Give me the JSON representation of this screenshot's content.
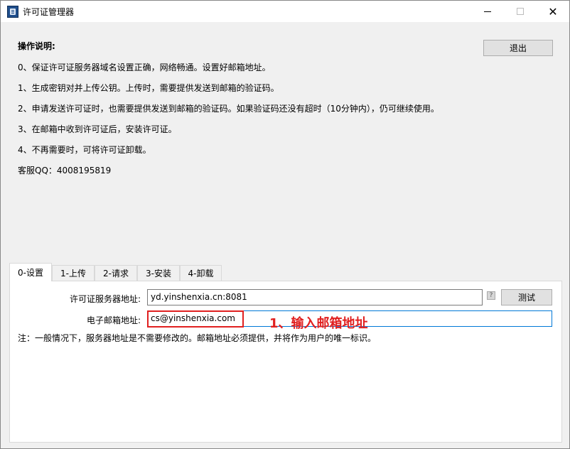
{
  "window": {
    "title": "许可证管理器",
    "close_glyph": "✕"
  },
  "instructions": {
    "heading": "操作说明:",
    "lines": [
      "0、保证许可证服务器域名设置正确，网络畅通。设置好邮箱地址。",
      "1、生成密钥对并上传公钥。上传时，需要提供发送到邮箱的验证码。",
      "2、申请发送许可证时，也需要提供发送到邮箱的验证码。如果验证码还没有超时（10分钟内），仍可继续使用。",
      "3、在邮箱中收到许可证后，安装许可证。",
      "4、不再需要时，可将许可证卸载。",
      "客服QQ：4008195819"
    ]
  },
  "exit_label": "退出",
  "tabs": [
    {
      "label": "0-设置",
      "active": true
    },
    {
      "label": "1-上传",
      "active": false
    },
    {
      "label": "2-请求",
      "active": false
    },
    {
      "label": "3-安装",
      "active": false
    },
    {
      "label": "4-卸载",
      "active": false
    }
  ],
  "settings": {
    "server_label": "许可证服务器地址:",
    "server_value": "yd.yinshenxia.cn:8081",
    "help_glyph": "?",
    "test_label": "测试",
    "email_label": "电子邮箱地址:",
    "email_value": "cs@yinshenxia.com",
    "note": "注：一般情况下，服务器地址是不需要修改的。邮箱地址必须提供，并将作为用户的唯一标识。"
  },
  "annotation": {
    "text": "1、输入邮箱地址",
    "color": "#e02020"
  },
  "icons": {
    "app": "license-manager-icon",
    "help": "question-mark-icon"
  }
}
